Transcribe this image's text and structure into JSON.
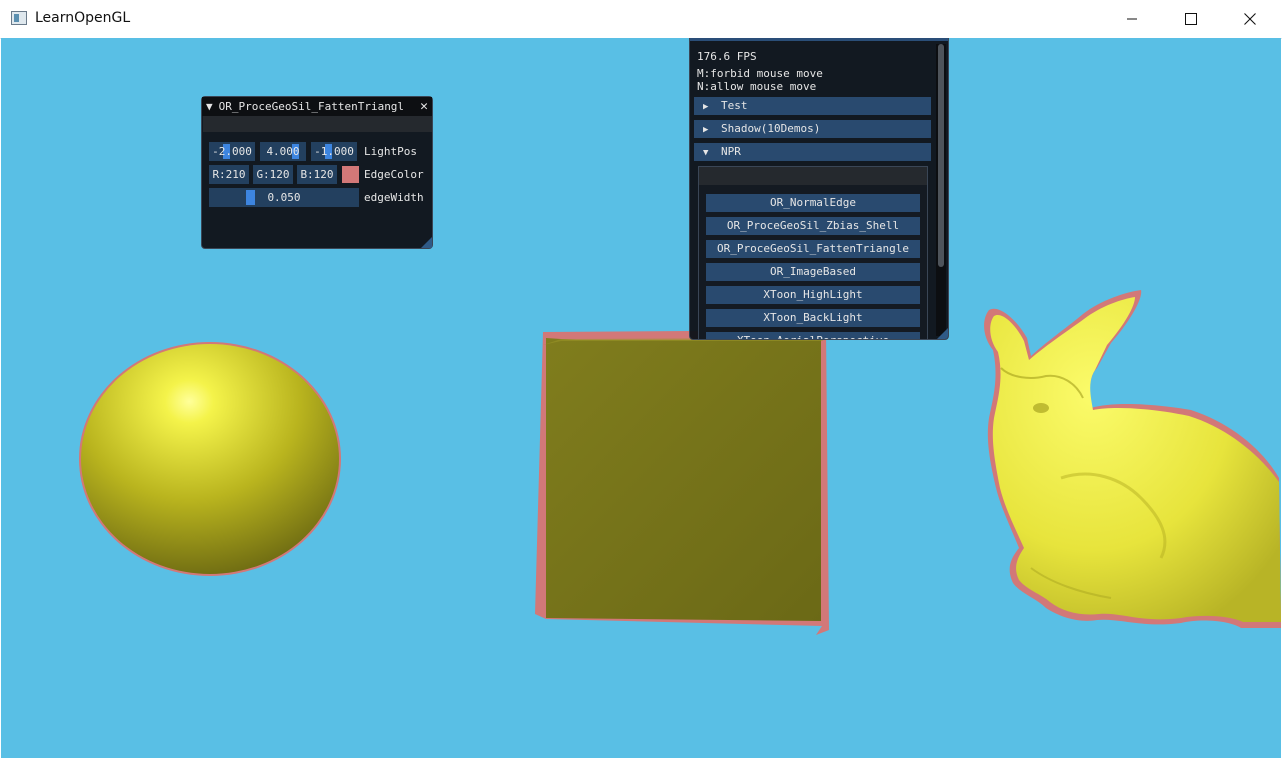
{
  "window": {
    "title": "LearnOpenGL",
    "icons": {
      "app": "opengl-app-icon",
      "minimize": "minimize-icon",
      "maximize": "maximize-icon",
      "close": "close-icon"
    }
  },
  "scene": {
    "background_color": "#59bfe5",
    "object_color": "#f0f05a",
    "edge_color": "#d27878",
    "objects": [
      "sphere",
      "cube",
      "stanford-bunny"
    ]
  },
  "npr_panel": {
    "title": "OR_ProceGeoSil_FattenTriangl",
    "collapse_icon": "▼",
    "close_icon": "✕",
    "light_pos": {
      "x": "-2.000",
      "y": "4.000",
      "z": "-1.000",
      "label": "LightPos"
    },
    "edge_color": {
      "r": "R:210",
      "g": "G:120",
      "b": "B:120",
      "label": "EdgeColor",
      "swatch": "#d27878"
    },
    "edge_width": {
      "value": "0.050",
      "label": "edgeWidth"
    }
  },
  "main_panel": {
    "fps": "176.6 FPS",
    "hint_forbid": "M:forbid mouse move",
    "hint_allow": "N:allow mouse move",
    "sections": [
      {
        "label": "Test",
        "arrow": "▶"
      },
      {
        "label": "Shadow(10Demos)",
        "arrow": "▶"
      },
      {
        "label": "NPR",
        "arrow": "▼"
      }
    ],
    "npr_buttons": [
      "OR_NormalEdge",
      "OR_ProceGeoSil_Zbias_Shell",
      "OR_ProceGeoSil_FattenTriangle",
      "OR_ImageBased",
      "XToon_HighLight",
      "XToon_BackLight",
      "XToon_AerialPerspective"
    ]
  }
}
